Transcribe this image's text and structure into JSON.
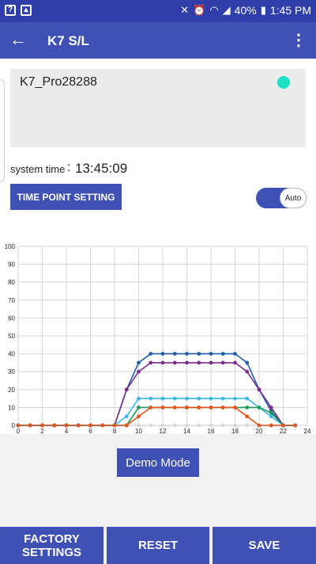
{
  "status_bar": {
    "battery": "40%",
    "time": "1:45 PM",
    "left_icons": [
      "help-box-icon",
      "image-icon"
    ],
    "right_icons": [
      "mute-icon",
      "alarm-icon",
      "wifi-icon",
      "signal-icon",
      "battery-icon"
    ]
  },
  "app_bar": {
    "title": "K7 S/L",
    "back_icon": "arrow-left-icon",
    "menu_icon": "more-vert-icon"
  },
  "device": {
    "name": "K7_Pro28288",
    "status_color": "#1de0c6"
  },
  "system_time": {
    "label": "system time",
    "separator": ":",
    "value": "13:45:09"
  },
  "time_point_button": "TIME POINT SETTING",
  "auto_toggle": {
    "label": "Auto",
    "on": true
  },
  "chart_data": {
    "type": "line",
    "xlim": [
      0,
      24
    ],
    "ylim": [
      0,
      100
    ],
    "x_ticks": [
      0,
      2,
      4,
      6,
      8,
      10,
      12,
      14,
      16,
      18,
      20,
      22,
      24
    ],
    "y_ticks": [
      0,
      10,
      20,
      30,
      40,
      50,
      60,
      70,
      80,
      90,
      100
    ],
    "grid": true,
    "x": [
      0,
      1,
      2,
      3,
      4,
      5,
      6,
      7,
      8,
      9,
      10,
      11,
      12,
      13,
      14,
      15,
      16,
      17,
      18,
      19,
      20,
      21,
      22,
      23
    ],
    "series": [
      {
        "color": "#d8d8d8",
        "values": [
          0,
          0,
          0,
          0,
          0,
          0,
          0,
          0,
          0,
          0,
          0,
          0,
          0,
          0,
          0,
          0,
          0,
          0,
          0,
          0,
          0,
          0,
          0,
          0
        ]
      },
      {
        "color": "#1f5fa6",
        "values": [
          0,
          0,
          0,
          0,
          0,
          0,
          0,
          0,
          0,
          20,
          35,
          40,
          40,
          40,
          40,
          40,
          40,
          40,
          40,
          35,
          20,
          8,
          0,
          0
        ]
      },
      {
        "color": "#7b2d8b",
        "values": [
          0,
          0,
          0,
          0,
          0,
          0,
          0,
          0,
          0,
          20,
          30,
          35,
          35,
          35,
          35,
          35,
          35,
          35,
          35,
          30,
          20,
          10,
          0,
          0
        ]
      },
      {
        "color": "#3db8e8",
        "values": [
          0,
          0,
          0,
          0,
          0,
          0,
          0,
          0,
          0,
          5,
          15,
          15,
          15,
          15,
          15,
          15,
          15,
          15,
          15,
          15,
          10,
          5,
          0,
          0
        ]
      },
      {
        "color": "#1b9a5a",
        "values": [
          0,
          0,
          0,
          0,
          0,
          0,
          0,
          0,
          0,
          0,
          10,
          10,
          10,
          10,
          10,
          10,
          10,
          10,
          10,
          10,
          10,
          7,
          0,
          0
        ]
      },
      {
        "color": "#e3541e",
        "values": [
          0,
          0,
          0,
          0,
          0,
          0,
          0,
          0,
          0,
          0,
          5,
          10,
          10,
          10,
          10,
          10,
          10,
          10,
          10,
          5,
          0,
          0,
          0,
          0
        ]
      }
    ]
  },
  "demo_button": "Demo Mode",
  "bottom_buttons": {
    "factory_line1": "FACTORY",
    "factory_line2": "SETTINGS",
    "reset": "RESET",
    "save": "SAVE"
  }
}
